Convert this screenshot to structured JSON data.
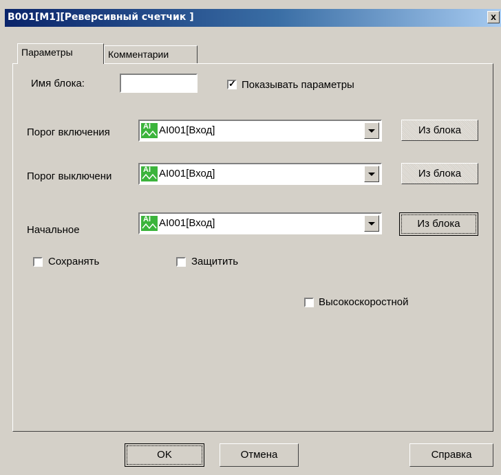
{
  "window": {
    "title": "B001[M1][Реверсивный счетчик ]",
    "close_label": "x"
  },
  "tabs": [
    "Параметры",
    "Комментарии"
  ],
  "block_name": {
    "label": "Имя блока:",
    "value": ""
  },
  "show_params": {
    "label": "Показывать параметры",
    "checked": true
  },
  "rows": [
    {
      "label": "Порог включения",
      "value": "AI001[Вход]",
      "icon": "AI",
      "button": "Из блока"
    },
    {
      "label": "Порог выключени",
      "value": "AI001[Вход]",
      "icon": "AI",
      "button": "Из блока"
    },
    {
      "label": "Начальное",
      "value": "AI001[Вход]",
      "icon": "AI",
      "button": "Из блока"
    }
  ],
  "checkboxes": {
    "save": "Сохранять",
    "protect": "Защитить",
    "highspeed": "Высокоскоростной"
  },
  "footer": {
    "ok": "OK",
    "cancel": "Отмена",
    "help": "Справка"
  }
}
